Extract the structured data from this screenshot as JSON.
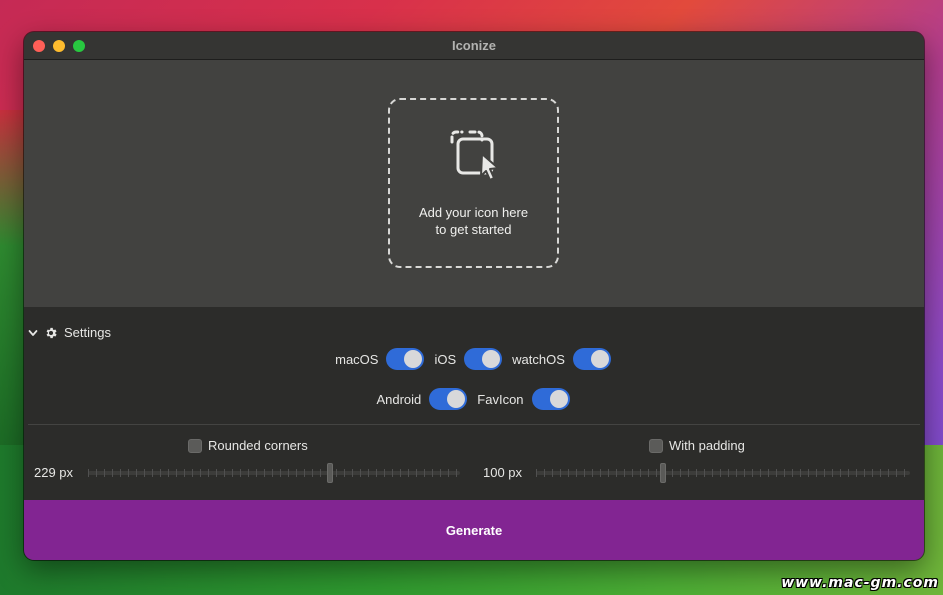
{
  "window": {
    "title": "Iconize"
  },
  "dropzone": {
    "line1": "Add your icon here",
    "line2": "to get started",
    "icon": "image-add-icon"
  },
  "settings": {
    "header": "Settings",
    "toggles_row1": [
      {
        "label": "macOS",
        "on": true
      },
      {
        "label": "iOS",
        "on": true
      },
      {
        "label": "watchOS",
        "on": true
      }
    ],
    "toggles_row2": [
      {
        "label": "Android",
        "on": true
      },
      {
        "label": "FavIcon",
        "on": true
      }
    ],
    "rounded": {
      "label": "Rounded corners",
      "checked": false,
      "value_label": "229 px",
      "fraction": 0.65
    },
    "padding": {
      "label": "With padding",
      "checked": false,
      "value_label": "100 px",
      "fraction": 0.34
    }
  },
  "generate": {
    "label": "Generate"
  },
  "watermark": "www.mac-gm.com",
  "colors": {
    "toggle_on": "#2f6bd8",
    "generate_bg": "#822592"
  }
}
